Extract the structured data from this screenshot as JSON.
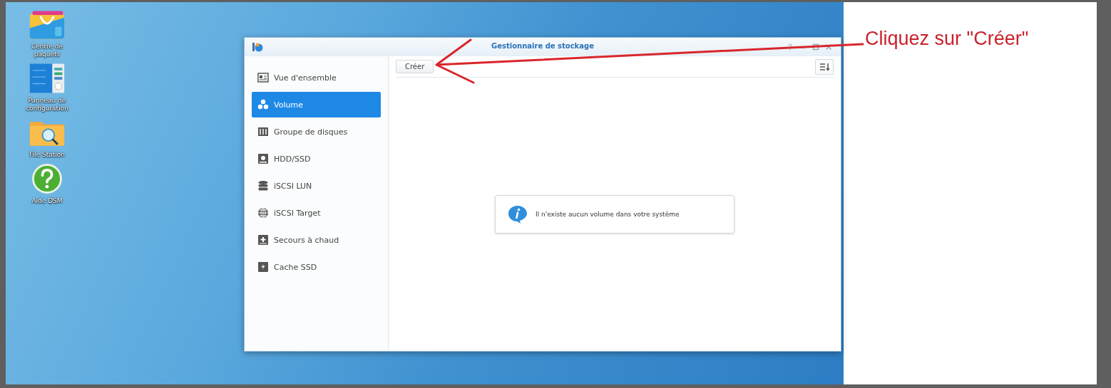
{
  "desktop_icons": [
    {
      "kind": "package",
      "label": "Centre de paquets"
    },
    {
      "kind": "control",
      "label": "Panneau de configuration"
    },
    {
      "kind": "folder",
      "label": "File Station"
    },
    {
      "kind": "help",
      "label": "Aide DSM"
    }
  ],
  "window": {
    "title": "Gestionnaire de stockage",
    "sidebar": {
      "items": [
        {
          "kind": "overview",
          "label": "Vue d'ensemble",
          "selected": false
        },
        {
          "kind": "volume",
          "label": "Volume",
          "selected": true
        },
        {
          "kind": "group",
          "label": "Groupe de disques",
          "selected": false
        },
        {
          "kind": "hdd",
          "label": "HDD/SSD",
          "selected": false
        },
        {
          "kind": "lun",
          "label": "iSCSI LUN",
          "selected": false
        },
        {
          "kind": "target",
          "label": "iSCSI Target",
          "selected": false
        },
        {
          "kind": "spare",
          "label": "Secours à chaud",
          "selected": false
        },
        {
          "kind": "cache",
          "label": "Cache SSD",
          "selected": false
        }
      ]
    },
    "toolbar": {
      "button": "Créer"
    },
    "empty_message": "Il n'existe aucun volume dans votre système"
  },
  "annotation": {
    "text": "Cliquez sur \"Créer\""
  }
}
